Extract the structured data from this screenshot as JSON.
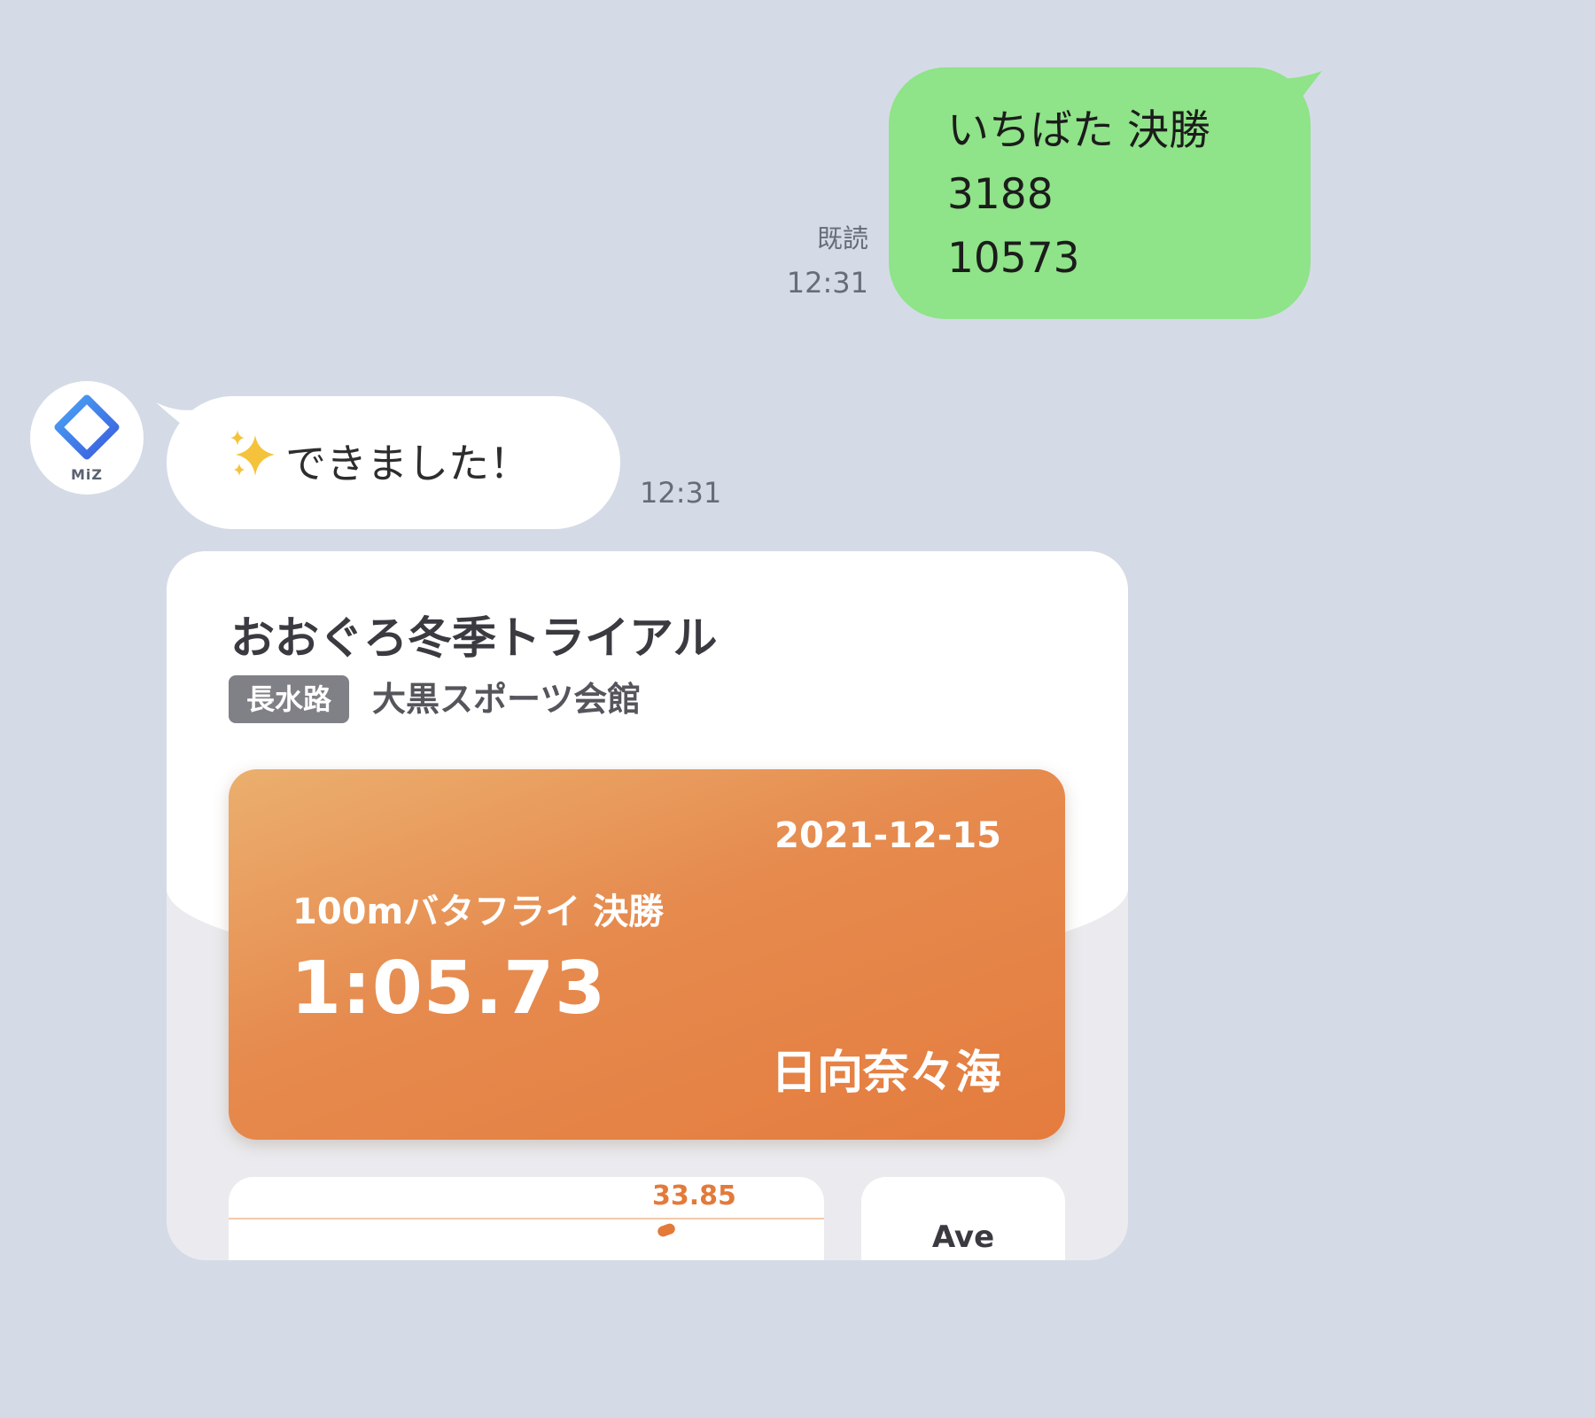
{
  "outgoing": {
    "lines": [
      "いちばた 決勝",
      "3188",
      "10573"
    ],
    "read_label": "既読",
    "time": "12:31",
    "bubble_color": "#8fe388"
  },
  "incoming": {
    "avatar_label": "MiZ",
    "avatar_icon": "diamond-logo-icon",
    "sparkle_icon": "sparkles-emoji",
    "text": "できました！",
    "time": "12:31"
  },
  "card": {
    "title": "おおぐろ冬季トライアル",
    "course_tag": "長水路",
    "venue": "大黒スポーツ会館",
    "result": {
      "date": "2021-12-15",
      "event": "100mバタフライ 決勝",
      "time": "1:05.73",
      "swimmer": "日向奈々海",
      "accent_color": "#e68a4e"
    },
    "split_value": "33.85",
    "ave_label": "Ave"
  },
  "background_color": "#d4dbe6"
}
